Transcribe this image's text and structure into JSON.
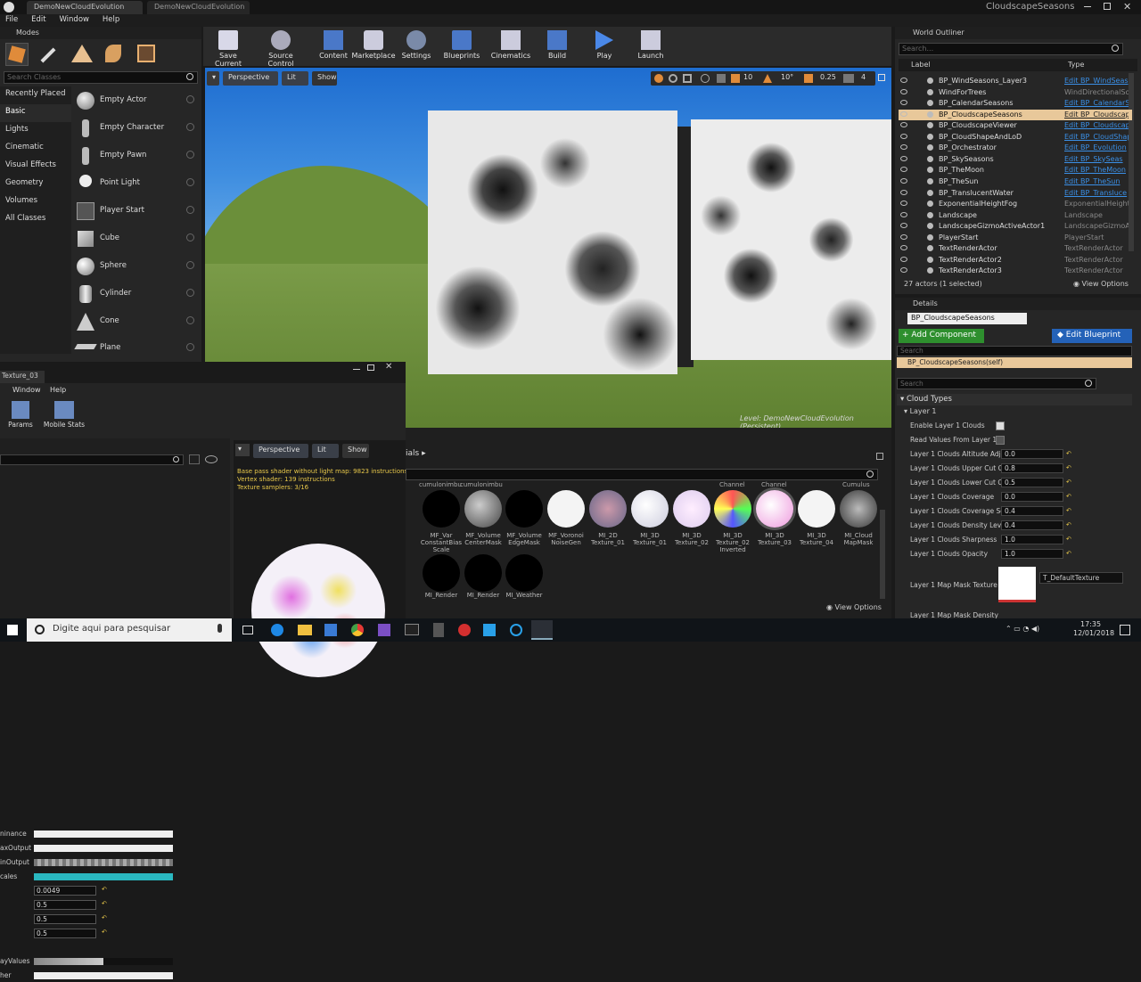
{
  "window": {
    "tabs": [
      "DemoNewCloudEvolution",
      "DemoNewCloudEvolution"
    ],
    "project": "CloudscapeSeasons"
  },
  "menu": [
    "File",
    "Edit",
    "Window",
    "Help"
  ],
  "modes": {
    "title": "Modes",
    "search_placeholder": "Search Classes",
    "categories": [
      "Recently Placed",
      "Basic",
      "Lights",
      "Cinematic",
      "Visual Effects",
      "Geometry",
      "Volumes",
      "All Classes"
    ],
    "items": [
      "Empty Actor",
      "Empty Character",
      "Empty Pawn",
      "Point Light",
      "Player Start",
      "Cube",
      "Sphere",
      "Cylinder",
      "Cone",
      "Plane"
    ]
  },
  "toolbar": [
    "Save Current",
    "Source Control",
    "Content",
    "Marketplace",
    "Settings",
    "Blueprints",
    "Cinematics",
    "Build",
    "Play",
    "Launch"
  ],
  "viewport": {
    "perspective": "Perspective",
    "lit": "Lit",
    "show": "Show",
    "grid_snap": "10",
    "rot_snap": "10°",
    "scale_snap": "0.25",
    "cam_speed": "4",
    "level_label": "Level:  DemoNewCloudEvolution (Persistent)"
  },
  "outliner": {
    "title": "World Outliner",
    "search_placeholder": "Search...",
    "col_label": "Label",
    "col_type": "Type",
    "rows": [
      {
        "name": "BP_WindSeasons_Layer3",
        "type": "Edit BP_WindSeas",
        "link": true
      },
      {
        "name": "WindForTrees",
        "type": "WindDirectionalSou",
        "link": false
      },
      {
        "name": "BP_CalendarSeasons",
        "type": "Edit BP_CalendarS",
        "link": true
      },
      {
        "name": "BP_CloudscapeSeasons",
        "type": "Edit BP_Cloudscap",
        "link": true
      },
      {
        "name": "BP_CloudscapeViewer",
        "type": "Edit BP_Cloudscap",
        "link": true
      },
      {
        "name": "BP_CloudShapeAndLoD",
        "type": "Edit BP_CloudShap",
        "link": true
      },
      {
        "name": "BP_Orchestrator",
        "type": "Edit BP_Evolution",
        "link": true
      },
      {
        "name": "BP_SkySeasons",
        "type": "Edit BP_SkySeas",
        "link": true
      },
      {
        "name": "BP_TheMoon",
        "type": "Edit BP_TheMoon",
        "link": true
      },
      {
        "name": "BP_TheSun",
        "type": "Edit BP_TheSun",
        "link": true
      },
      {
        "name": "BP_TranslucentWater",
        "type": "Edit BP_Transluce",
        "link": true
      },
      {
        "name": "ExponentialHeightFog",
        "type": "ExponentialHeightF",
        "link": false
      },
      {
        "name": "Landscape",
        "type": "Landscape",
        "link": false
      },
      {
        "name": "LandscapeGizmoActiveActor1",
        "type": "LandscapeGizmoA",
        "link": false
      },
      {
        "name": "PlayerStart",
        "type": "PlayerStart",
        "link": false
      },
      {
        "name": "TextRenderActor",
        "type": "TextRenderActor",
        "link": false
      },
      {
        "name": "TextRenderActor2",
        "type": "TextRenderActor",
        "link": false
      },
      {
        "name": "TextRenderActor3",
        "type": "TextRenderActor",
        "link": false
      }
    ],
    "status": "27 actors (1 selected)",
    "view_options": "View Options"
  },
  "details": {
    "title": "Details",
    "actor_name": "BP_CloudscapeSeasons",
    "add_component": "+ Add Component",
    "edit_blueprint": "Edit Blueprint",
    "search_placeholder": "Search",
    "self_component": "BP_CloudscapeSeasons(self)",
    "search2_placeholder": "Search",
    "category": "Cloud Types",
    "sub": "Layer 1",
    "props": [
      {
        "label": "Enable Layer 1 Clouds",
        "kind": "check",
        "value": ""
      },
      {
        "label": "Read Values From Layer 1 N",
        "kind": "check",
        "value": ""
      },
      {
        "label": "Layer 1 Clouds Altitude Adj",
        "kind": "num",
        "value": "0.0"
      },
      {
        "label": "Layer 1 Clouds Upper Cut O",
        "kind": "num",
        "value": "0.8"
      },
      {
        "label": "Layer 1 Clouds Lower Cut O",
        "kind": "num",
        "value": "0.5"
      },
      {
        "label": "Layer 1 Clouds Coverage",
        "kind": "num",
        "value": "0.0"
      },
      {
        "label": "Layer 1 Clouds Coverage Sc",
        "kind": "num",
        "value": "0.4"
      },
      {
        "label": "Layer 1 Clouds Density Leve",
        "kind": "num",
        "value": "0.4"
      },
      {
        "label": "Layer 1 Clouds Sharpness",
        "kind": "num",
        "value": "1.0"
      },
      {
        "label": "Layer 1 Clouds Opacity",
        "kind": "num",
        "value": "1.0"
      }
    ],
    "mask_label": "Layer 1 Map Mask Texture",
    "mask_value": "T_DefaultTexture",
    "mask_density": "Layer 1 Map Mask Density"
  },
  "matedit": {
    "tab": "Texture_03",
    "menu": [
      "Window",
      "Help"
    ],
    "params": "Params",
    "mobile": "Mobile Stats",
    "rows": [
      {
        "label": "ninance",
        "val": ""
      },
      {
        "label": "axOutput",
        "val": ""
      },
      {
        "label": "inOutput",
        "val": ""
      },
      {
        "label": "cales",
        "val": ""
      },
      {
        "label": "",
        "val": "0.0049"
      },
      {
        "label": "",
        "val": "0.5"
      },
      {
        "label": "",
        "val": "0.5"
      },
      {
        "label": "",
        "val": "0.5"
      },
      {
        "label": "ayValues",
        "val": ""
      },
      {
        "label": "her",
        "val": ""
      }
    ],
    "stats": [
      "Base pass shader without light map: 9823 instructions",
      "Vertex shader: 139 instructions",
      "Texture samplers: 3/16"
    ]
  },
  "content": {
    "breadcrumb": "ials",
    "cut_labels": [
      "cumulonimbu",
      "cumulonimbu",
      "Channel",
      "Channel",
      "Cumulus"
    ],
    "items": [
      {
        "label": "MF_Var ConstantBias Scale"
      },
      {
        "label": "MF_Volume CenterMask"
      },
      {
        "label": "MF_Volume EdgeMask"
      },
      {
        "label": "MF_Voronoi NoiseGen"
      },
      {
        "label": "MI_2D Texture_01"
      },
      {
        "label": "MI_3D Texture_01"
      },
      {
        "label": "MI_3D Texture_02"
      },
      {
        "label": "MI_3D Texture_02 Inverted"
      },
      {
        "label": "MI_3D Texture_03"
      },
      {
        "label": "MI_3D Texture_04"
      },
      {
        "label": "MI_Cloud MapMask"
      }
    ],
    "row2": [
      "MI_Render",
      "MI_Render",
      "MI_Weather"
    ],
    "view_options": "View Options"
  },
  "taskbar": {
    "search": "Digite aqui para pesquisar",
    "time": "17:35",
    "date": "12/01/2018"
  }
}
